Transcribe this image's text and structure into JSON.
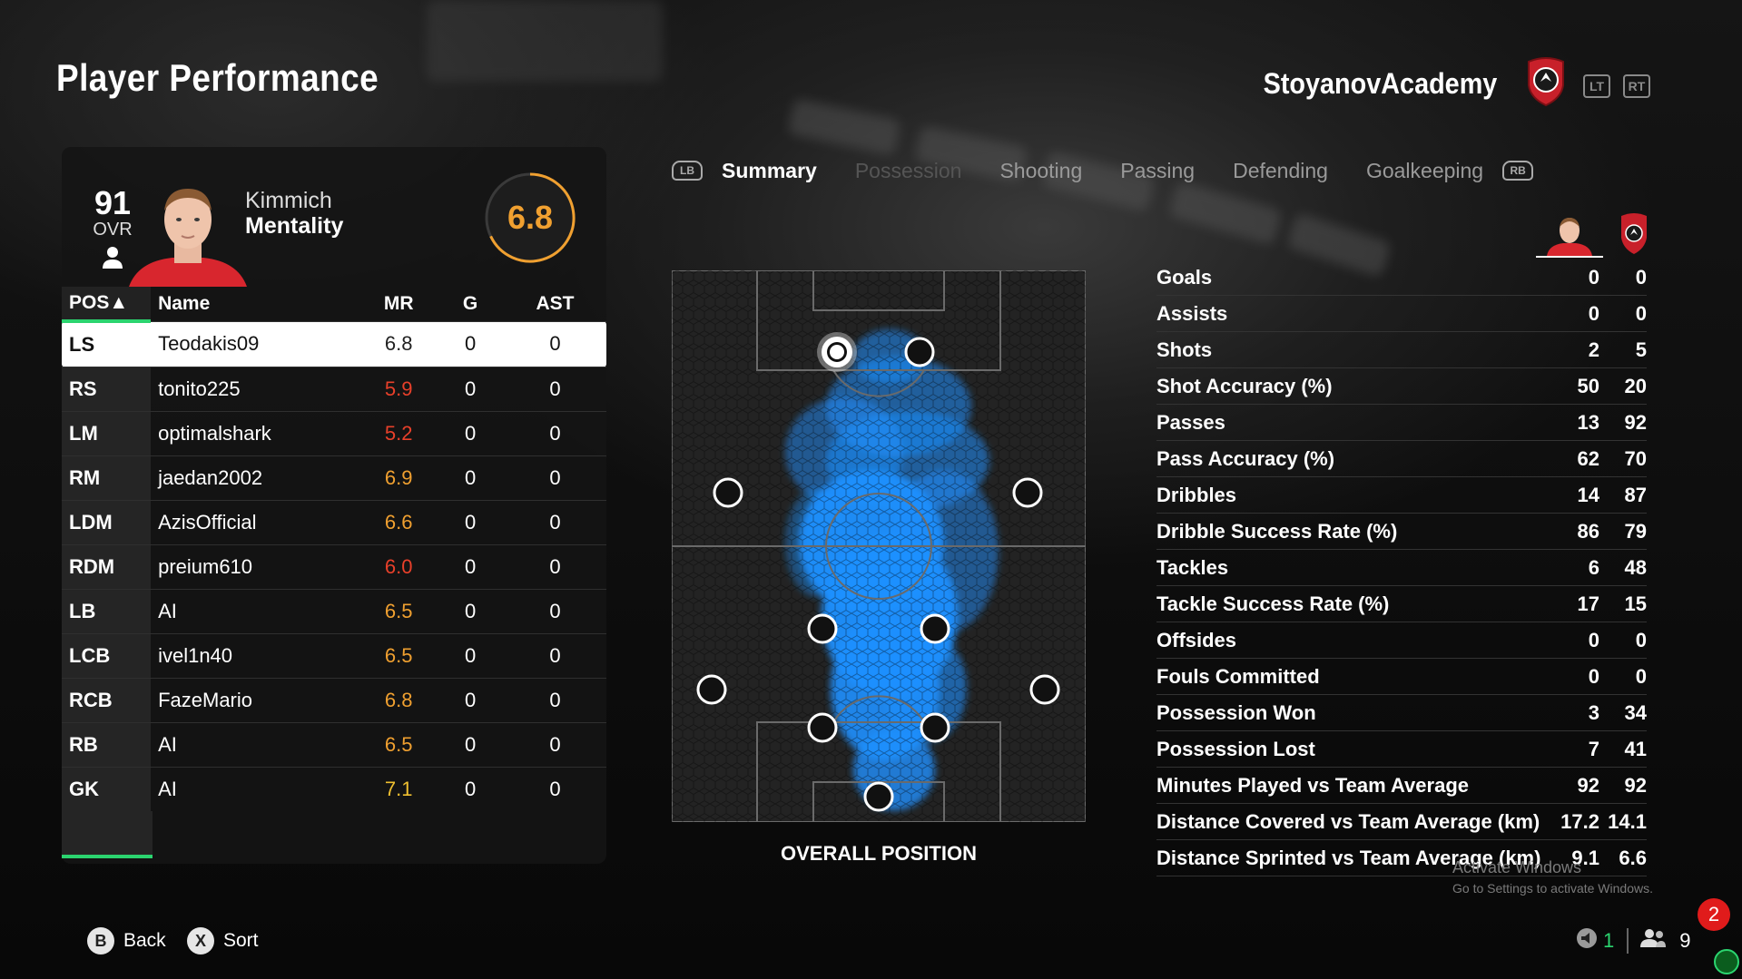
{
  "page": {
    "title": "Player Performance",
    "club_name": "StoyanovAcademy",
    "left_trigger": "LT",
    "right_trigger": "RT"
  },
  "player_card": {
    "ovr": "91",
    "ovr_label": "OVR",
    "name": "Kimmich",
    "style": "Mentality",
    "rating": "6.8"
  },
  "table": {
    "headers": {
      "pos": "POS▲",
      "name": "Name",
      "mr": "MR",
      "g": "G",
      "ast": "AST"
    },
    "rows": [
      {
        "pos": "LS",
        "name": "Teodakis09",
        "mr": "6.8",
        "g": "0",
        "ast": "0",
        "mr_color": "#222222",
        "selected": true
      },
      {
        "pos": "RS",
        "name": "tonito225",
        "mr": "5.9",
        "g": "0",
        "ast": "0",
        "mr_color": "#e8402a"
      },
      {
        "pos": "LM",
        "name": "optimalshark",
        "mr": "5.2",
        "g": "0",
        "ast": "0",
        "mr_color": "#e8402a"
      },
      {
        "pos": "RM",
        "name": "jaedan2002",
        "mr": "6.9",
        "g": "0",
        "ast": "0",
        "mr_color": "#f0a030"
      },
      {
        "pos": "LDM",
        "name": "AzisOfficial",
        "mr": "6.6",
        "g": "0",
        "ast": "0",
        "mr_color": "#f0a030"
      },
      {
        "pos": "RDM",
        "name": "preium610",
        "mr": "6.0",
        "g": "0",
        "ast": "0",
        "mr_color": "#e8402a"
      },
      {
        "pos": "LB",
        "name": "AI",
        "mr": "6.5",
        "g": "0",
        "ast": "0",
        "mr_color": "#f0a030"
      },
      {
        "pos": "LCB",
        "name": "ivel1n40",
        "mr": "6.5",
        "g": "0",
        "ast": "0",
        "mr_color": "#f0a030"
      },
      {
        "pos": "RCB",
        "name": "FazeMario",
        "mr": "6.8",
        "g": "0",
        "ast": "0",
        "mr_color": "#f0a030"
      },
      {
        "pos": "RB",
        "name": "AI",
        "mr": "6.5",
        "g": "0",
        "ast": "0",
        "mr_color": "#f0a030"
      },
      {
        "pos": "GK",
        "name": "AI",
        "mr": "7.1",
        "g": "0",
        "ast": "0",
        "mr_color": "#f0c030"
      }
    ]
  },
  "tabs": {
    "left_bumper": "LB",
    "right_bumper": "RB",
    "items": [
      "Summary",
      "Possession",
      "Shooting",
      "Passing",
      "Defending",
      "Goalkeeping"
    ],
    "active": "Summary"
  },
  "pitch": {
    "caption": "OVERALL POSITION"
  },
  "stats": [
    {
      "label": "Goals",
      "player": "0",
      "team": "0"
    },
    {
      "label": "Assists",
      "player": "0",
      "team": "0"
    },
    {
      "label": "Shots",
      "player": "2",
      "team": "5"
    },
    {
      "label": "Shot Accuracy (%)",
      "player": "50",
      "team": "20"
    },
    {
      "label": "Passes",
      "player": "13",
      "team": "92"
    },
    {
      "label": "Pass Accuracy (%)",
      "player": "62",
      "team": "70"
    },
    {
      "label": "Dribbles",
      "player": "14",
      "team": "87"
    },
    {
      "label": "Dribble Success Rate (%)",
      "player": "86",
      "team": "79"
    },
    {
      "label": "Tackles",
      "player": "6",
      "team": "48"
    },
    {
      "label": "Tackle Success Rate (%)",
      "player": "17",
      "team": "15"
    },
    {
      "label": "Offsides",
      "player": "0",
      "team": "0"
    },
    {
      "label": "Fouls Committed",
      "player": "0",
      "team": "0"
    },
    {
      "label": "Possession Won",
      "player": "3",
      "team": "34"
    },
    {
      "label": "Possession Lost",
      "player": "7",
      "team": "41"
    },
    {
      "label": "Minutes Played vs Team Average",
      "player": "92",
      "team": "92"
    },
    {
      "label": "Distance Covered vs Team Average (km)",
      "player": "17.2",
      "team": "14.1"
    },
    {
      "label": "Distance Sprinted vs Team Average (km)",
      "player": "9.1",
      "team": "6.6"
    }
  ],
  "watermark": {
    "title": "Activate Windows",
    "subtitle": "Go to Settings to activate Windows."
  },
  "footer": {
    "back_key": "B",
    "back_label": "Back",
    "sort_key": "X",
    "sort_label": "Sort",
    "notification_count": "2",
    "voice_count": "1",
    "party_count": "9"
  },
  "colors": {
    "accent_green": "#2bd46f",
    "rating_orange": "#f0a030",
    "rating_red": "#e8402a",
    "heat_blue": "#1e90ff",
    "crest_red": "#c8202a"
  }
}
